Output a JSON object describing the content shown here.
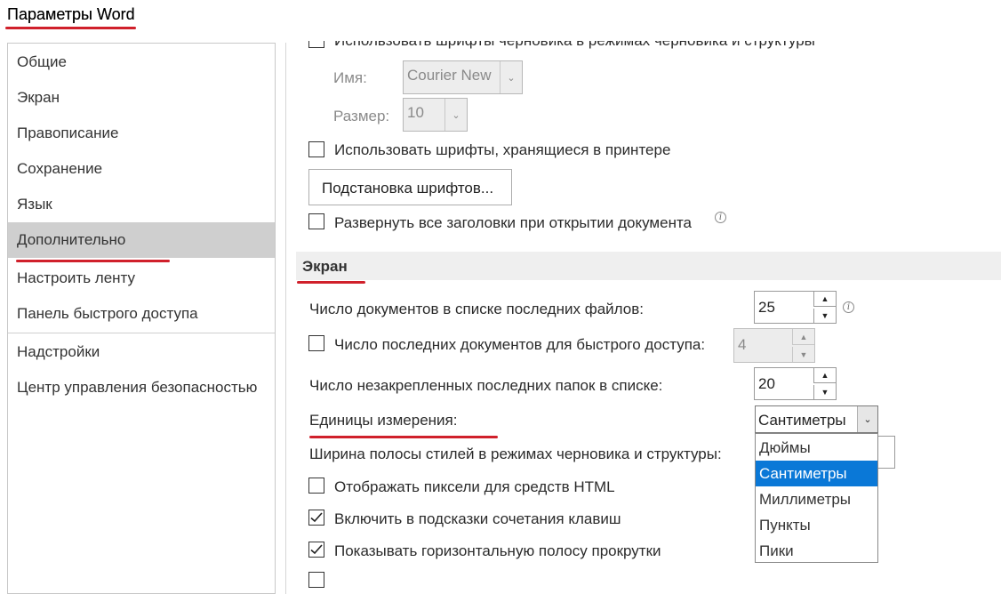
{
  "window": {
    "title": "Параметры Word"
  },
  "sidebar": {
    "items": [
      {
        "label": "Общие"
      },
      {
        "label": "Экран"
      },
      {
        "label": "Правописание"
      },
      {
        "label": "Сохранение"
      },
      {
        "label": "Язык"
      },
      {
        "label": "Дополнительно",
        "selected": true
      },
      {
        "label": "Настроить ленту"
      },
      {
        "label": "Панель быстрого доступа"
      },
      {
        "label": "Надстройки"
      },
      {
        "label": "Центр управления безопасностью"
      }
    ]
  },
  "top_section": {
    "draft_fonts_label": "Использовать шрифты черновика в режимах черновика и структуры",
    "name_label": "Имя:",
    "name_value": "Courier New",
    "size_label": "Размер:",
    "size_value": "10",
    "printer_fonts_label": "Использовать шрифты, хранящиеся в принтере",
    "font_substitution_button": "Подстановка шрифтов...",
    "expand_headings_label": "Развернуть все заголовки при открытии документа"
  },
  "display_section": {
    "title": "Экран",
    "recent_docs_label": "Число документов в списке последних файлов:",
    "recent_docs_value": "25",
    "quick_access_label": "Число последних документов для быстрого доступа:",
    "quick_access_value": "4",
    "unpinned_folders_label": "Число незакрепленных последних папок в списке:",
    "unpinned_folders_value": "20",
    "units_label": "Единицы измерения:",
    "units_value": "Сантиметры",
    "units_options": [
      {
        "label": "Дюймы"
      },
      {
        "label": "Сантиметры",
        "selected": true
      },
      {
        "label": "Миллиметры"
      },
      {
        "label": "Пункты"
      },
      {
        "label": "Пики"
      }
    ],
    "style_area_label": "Ширина полосы стилей в режимах черновика и структуры:",
    "html_pixels_label": "Отображать пиксели для средств HTML",
    "shortcut_keys_label": "Включить в подсказки сочетания клавиш",
    "shortcut_keys_checked": true,
    "horizontal_scroll_label": "Показывать горизонтальную полосу прокрутки",
    "horizontal_scroll_checked": true
  },
  "colors": {
    "accent": "#0a78d7",
    "highlight_underline": "#d0202b",
    "selected_item": "#cfcfcf"
  }
}
